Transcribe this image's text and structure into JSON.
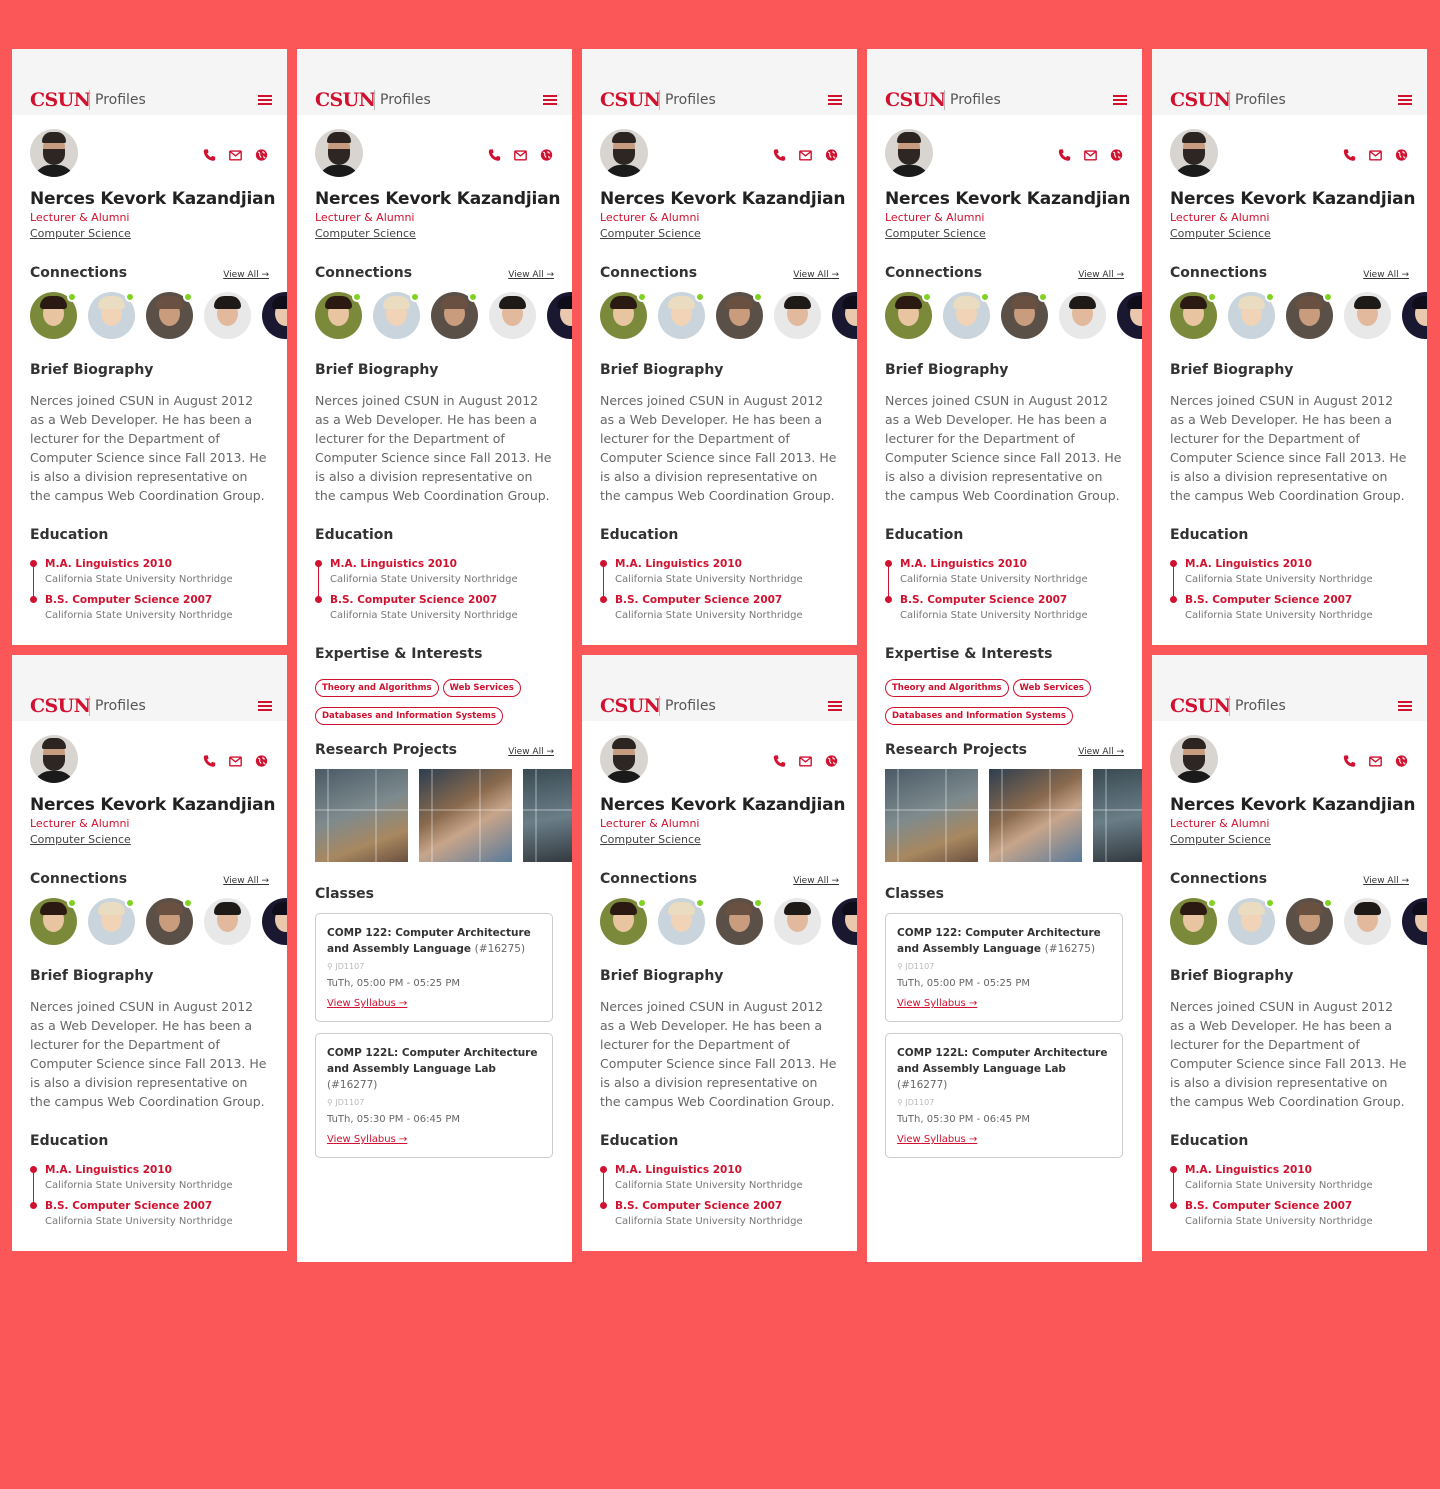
{
  "header": {
    "logo": "CSUN",
    "app_name": "Profiles"
  },
  "icons": {
    "menu": "hamburger-menu-icon",
    "phone": "phone-icon",
    "email": "envelope-icon",
    "website": "globe-icon",
    "room": "map-pin-icon"
  },
  "colors": {
    "background": "#fb5658",
    "accent": "#d0112f",
    "online": "#7ed321"
  },
  "profile": {
    "name": "Nerces Kevork Kazandjian",
    "role": "Lecturer & Alumni",
    "department": "Computer Science"
  },
  "connections": {
    "title": "Connections",
    "view_all": "View All →"
  },
  "biography": {
    "title": "Brief Biography",
    "text": "Nerces joined CSUN in August 2012 as a Web Developer. He has been a lecturer for the Department of Computer Science since Fall 2013. He is also a division representative on the campus Web Coordination Group."
  },
  "education": {
    "title": "Education",
    "items": [
      {
        "degree": "M.A. Linguistics 2010",
        "school": "California State University Northridge"
      },
      {
        "degree": "B.S. Computer Science 2007",
        "school": "California State University Northridge"
      }
    ]
  },
  "expertise": {
    "title": "Expertise & Interests",
    "tags": [
      "Theory and Algorithms",
      "Web Services",
      "Databases and Information Systems"
    ]
  },
  "research": {
    "title": "Research Projects",
    "view_all": "View All →"
  },
  "classes": {
    "title": "Classes",
    "items": [
      {
        "title": "COMP 122: Computer Architecture and Assembly Language",
        "number": "(#16275)",
        "room": "JD1107",
        "time": "TuTh, 05:00 PM - 05:25 PM",
        "link": "View Syllabus →"
      },
      {
        "title": "COMP 122L: Computer Architecture and Assembly Language Lab",
        "number": "(#16277)",
        "room": "JD1107",
        "time": "TuTh, 05:30 PM - 06:45 PM",
        "link": "View Syllabus →"
      }
    ]
  }
}
